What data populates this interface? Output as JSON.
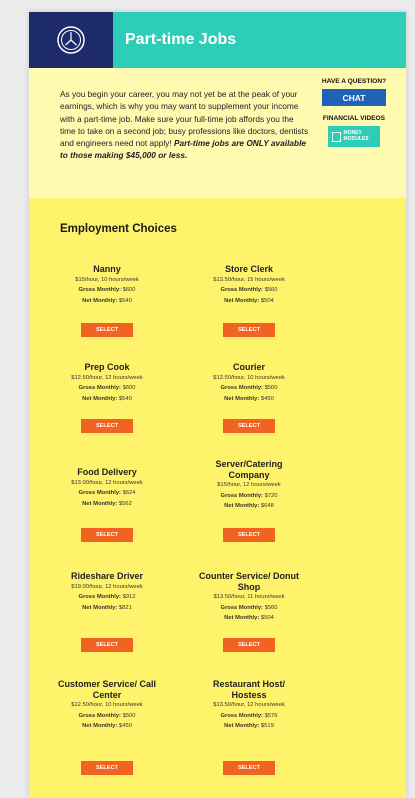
{
  "header": {
    "title": "Part-time Jobs"
  },
  "intro": {
    "text": "As you begin your career, you may not yet be at the peak of your earnings, which is why you may want to supplement your income with a part-time job. Make sure your full-time job affords you the time to take on a second job; busy professions like doctors, dentists and engineers need not apply! ",
    "bold": "Part-time jobs are ONLY available to those making $45,000 or less."
  },
  "side": {
    "question_label": "HAVE A QUESTION?",
    "chat_label": "CHAT",
    "videos_label": "FINANCIAL VIDEOS",
    "money_modules_label": "MONEY MODULES"
  },
  "section_title": "Employment Choices",
  "select_label": "SELECT",
  "gross_label": "Gross Monthly:",
  "net_label": "Net Monthly:",
  "jobs": [
    {
      "title": "Nanny",
      "rate": "$15/hour, 10 hours/week",
      "gross": "$600",
      "net": "$540"
    },
    {
      "title": "Store Clerk",
      "rate": "$13.50/hour, 15 hours/week",
      "gross": "$560",
      "net": "$504"
    },
    {
      "title": "Prep Cook",
      "rate": "$12.50/hour, 12 hours/week",
      "gross": "$600",
      "net": "$540"
    },
    {
      "title": "Courier",
      "rate": "$12.50/hour, 10 hours/week",
      "gross": "$500",
      "net": "$450"
    },
    {
      "title": "Food Delivery",
      "rate": "$13.00/hour, 12 hours/week",
      "gross": "$624",
      "net": "$562"
    },
    {
      "title": "Server/Catering Company",
      "rate": "$15/hour, 12 hours/week",
      "gross": "$720",
      "net": "$648"
    },
    {
      "title": "Rideshare Driver",
      "rate": "$19.00/hour, 12 hours/week",
      "gross": "$912",
      "net": "$821"
    },
    {
      "title": "Counter Service/ Donut Shop",
      "rate": "$13.50/hour, 11 hours/week",
      "gross": "$560",
      "net": "$504"
    },
    {
      "title": "Customer Service/ Call Center",
      "rate": "$12.50/hour, 10 hours/week",
      "gross": "$500",
      "net": "$450"
    },
    {
      "title": "Restaurant Host/ Hostess",
      "rate": "$13.50/hour, 12 hours/week",
      "gross": "$576",
      "net": "$519"
    }
  ]
}
